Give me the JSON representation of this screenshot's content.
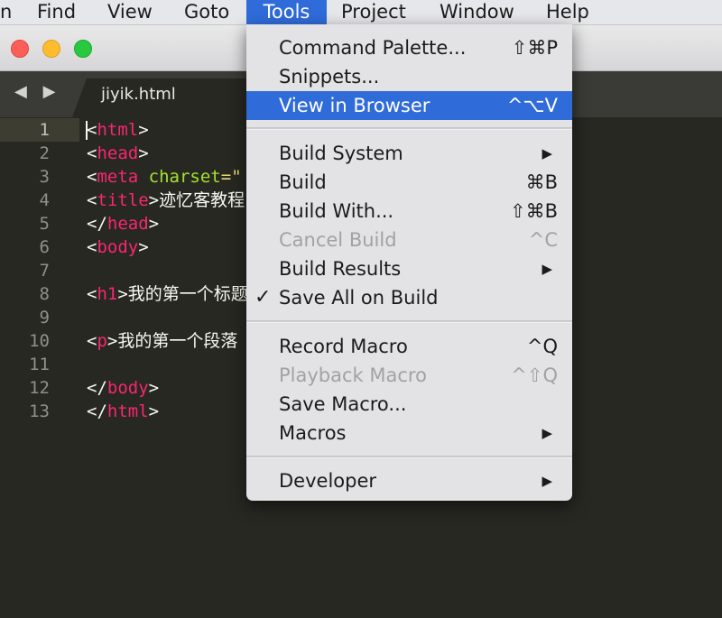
{
  "menubar": {
    "items": [
      {
        "label": "n"
      },
      {
        "label": "Find"
      },
      {
        "label": "View"
      },
      {
        "label": "Goto"
      },
      {
        "label": "Tools"
      },
      {
        "label": "Project"
      },
      {
        "label": "Window"
      },
      {
        "label": "Help"
      }
    ],
    "active": "Tools"
  },
  "tabbar": {
    "nav_arrows": "◀ ▶",
    "active_tab": "jiyik.html"
  },
  "editor": {
    "line_numbers": [
      "1",
      "2",
      "3",
      "4",
      "5",
      "6",
      "7",
      "8",
      "9",
      "10",
      "11",
      "12",
      "13"
    ],
    "current_line": 1,
    "code": {
      "l1_tag": "html",
      "l2_tag": "head",
      "l3_tag": "meta",
      "l3_attr": "charset",
      "l3_rest": "=\"",
      "l4_tag": "title",
      "l4_text": "迹忆客教程",
      "l5_tag": "head",
      "l6_tag": "body",
      "l8_tag": "h1",
      "l8_text": "我的第一个标题",
      "l10_tag": "p",
      "l10_text": "我的第一个段落",
      "l12_tag": "body",
      "l13_tag": "html"
    }
  },
  "tools_menu": {
    "command_palette": {
      "label": "Command Palette...",
      "shortcut": "⇧⌘P"
    },
    "snippets": {
      "label": "Snippets..."
    },
    "view_in_browser": {
      "label": "View in Browser",
      "shortcut": "^⌥V"
    },
    "build_system": {
      "label": "Build System"
    },
    "build": {
      "label": "Build",
      "shortcut": "⌘B"
    },
    "build_with": {
      "label": "Build With...",
      "shortcut": "⇧⌘B"
    },
    "cancel_build": {
      "label": "Cancel Build",
      "shortcut": "^C"
    },
    "build_results": {
      "label": "Build Results"
    },
    "save_all_on_build": {
      "label": "Save All on Build",
      "checkmark": "✓"
    },
    "record_macro": {
      "label": "Record Macro",
      "shortcut": "^Q"
    },
    "playback_macro": {
      "label": "Playback Macro",
      "shortcut": "^⇧Q"
    },
    "save_macro": {
      "label": "Save Macro..."
    },
    "macros": {
      "label": "Macros"
    },
    "developer": {
      "label": "Developer"
    },
    "submenu_arrow": "▶"
  },
  "colors": {
    "editor_bg": "#272822",
    "tag": "#f92672",
    "attr": "#a6e22e",
    "string": "#e6db74",
    "highlight": "#2f6bd9"
  }
}
